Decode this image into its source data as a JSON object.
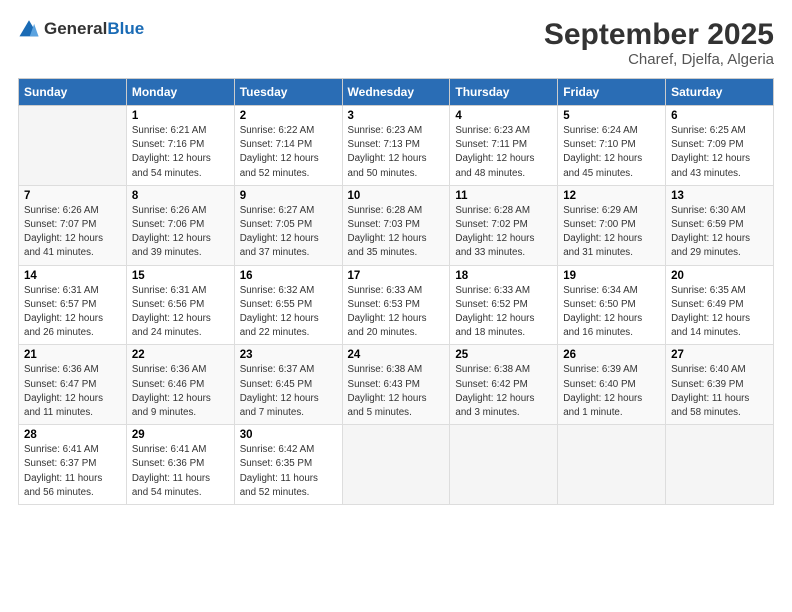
{
  "header": {
    "logo_general": "General",
    "logo_blue": "Blue",
    "title": "September 2025",
    "subtitle": "Charef, Djelfa, Algeria"
  },
  "days_of_week": [
    "Sunday",
    "Monday",
    "Tuesday",
    "Wednesday",
    "Thursday",
    "Friday",
    "Saturday"
  ],
  "weeks": [
    [
      {
        "num": "",
        "detail": ""
      },
      {
        "num": "1",
        "detail": "Sunrise: 6:21 AM\nSunset: 7:16 PM\nDaylight: 12 hours\nand 54 minutes."
      },
      {
        "num": "2",
        "detail": "Sunrise: 6:22 AM\nSunset: 7:14 PM\nDaylight: 12 hours\nand 52 minutes."
      },
      {
        "num": "3",
        "detail": "Sunrise: 6:23 AM\nSunset: 7:13 PM\nDaylight: 12 hours\nand 50 minutes."
      },
      {
        "num": "4",
        "detail": "Sunrise: 6:23 AM\nSunset: 7:11 PM\nDaylight: 12 hours\nand 48 minutes."
      },
      {
        "num": "5",
        "detail": "Sunrise: 6:24 AM\nSunset: 7:10 PM\nDaylight: 12 hours\nand 45 minutes."
      },
      {
        "num": "6",
        "detail": "Sunrise: 6:25 AM\nSunset: 7:09 PM\nDaylight: 12 hours\nand 43 minutes."
      }
    ],
    [
      {
        "num": "7",
        "detail": "Sunrise: 6:26 AM\nSunset: 7:07 PM\nDaylight: 12 hours\nand 41 minutes."
      },
      {
        "num": "8",
        "detail": "Sunrise: 6:26 AM\nSunset: 7:06 PM\nDaylight: 12 hours\nand 39 minutes."
      },
      {
        "num": "9",
        "detail": "Sunrise: 6:27 AM\nSunset: 7:05 PM\nDaylight: 12 hours\nand 37 minutes."
      },
      {
        "num": "10",
        "detail": "Sunrise: 6:28 AM\nSunset: 7:03 PM\nDaylight: 12 hours\nand 35 minutes."
      },
      {
        "num": "11",
        "detail": "Sunrise: 6:28 AM\nSunset: 7:02 PM\nDaylight: 12 hours\nand 33 minutes."
      },
      {
        "num": "12",
        "detail": "Sunrise: 6:29 AM\nSunset: 7:00 PM\nDaylight: 12 hours\nand 31 minutes."
      },
      {
        "num": "13",
        "detail": "Sunrise: 6:30 AM\nSunset: 6:59 PM\nDaylight: 12 hours\nand 29 minutes."
      }
    ],
    [
      {
        "num": "14",
        "detail": "Sunrise: 6:31 AM\nSunset: 6:57 PM\nDaylight: 12 hours\nand 26 minutes."
      },
      {
        "num": "15",
        "detail": "Sunrise: 6:31 AM\nSunset: 6:56 PM\nDaylight: 12 hours\nand 24 minutes."
      },
      {
        "num": "16",
        "detail": "Sunrise: 6:32 AM\nSunset: 6:55 PM\nDaylight: 12 hours\nand 22 minutes."
      },
      {
        "num": "17",
        "detail": "Sunrise: 6:33 AM\nSunset: 6:53 PM\nDaylight: 12 hours\nand 20 minutes."
      },
      {
        "num": "18",
        "detail": "Sunrise: 6:33 AM\nSunset: 6:52 PM\nDaylight: 12 hours\nand 18 minutes."
      },
      {
        "num": "19",
        "detail": "Sunrise: 6:34 AM\nSunset: 6:50 PM\nDaylight: 12 hours\nand 16 minutes."
      },
      {
        "num": "20",
        "detail": "Sunrise: 6:35 AM\nSunset: 6:49 PM\nDaylight: 12 hours\nand 14 minutes."
      }
    ],
    [
      {
        "num": "21",
        "detail": "Sunrise: 6:36 AM\nSunset: 6:47 PM\nDaylight: 12 hours\nand 11 minutes."
      },
      {
        "num": "22",
        "detail": "Sunrise: 6:36 AM\nSunset: 6:46 PM\nDaylight: 12 hours\nand 9 minutes."
      },
      {
        "num": "23",
        "detail": "Sunrise: 6:37 AM\nSunset: 6:45 PM\nDaylight: 12 hours\nand 7 minutes."
      },
      {
        "num": "24",
        "detail": "Sunrise: 6:38 AM\nSunset: 6:43 PM\nDaylight: 12 hours\nand 5 minutes."
      },
      {
        "num": "25",
        "detail": "Sunrise: 6:38 AM\nSunset: 6:42 PM\nDaylight: 12 hours\nand 3 minutes."
      },
      {
        "num": "26",
        "detail": "Sunrise: 6:39 AM\nSunset: 6:40 PM\nDaylight: 12 hours\nand 1 minute."
      },
      {
        "num": "27",
        "detail": "Sunrise: 6:40 AM\nSunset: 6:39 PM\nDaylight: 11 hours\nand 58 minutes."
      }
    ],
    [
      {
        "num": "28",
        "detail": "Sunrise: 6:41 AM\nSunset: 6:37 PM\nDaylight: 11 hours\nand 56 minutes."
      },
      {
        "num": "29",
        "detail": "Sunrise: 6:41 AM\nSunset: 6:36 PM\nDaylight: 11 hours\nand 54 minutes."
      },
      {
        "num": "30",
        "detail": "Sunrise: 6:42 AM\nSunset: 6:35 PM\nDaylight: 11 hours\nand 52 minutes."
      },
      {
        "num": "",
        "detail": ""
      },
      {
        "num": "",
        "detail": ""
      },
      {
        "num": "",
        "detail": ""
      },
      {
        "num": "",
        "detail": ""
      }
    ]
  ]
}
